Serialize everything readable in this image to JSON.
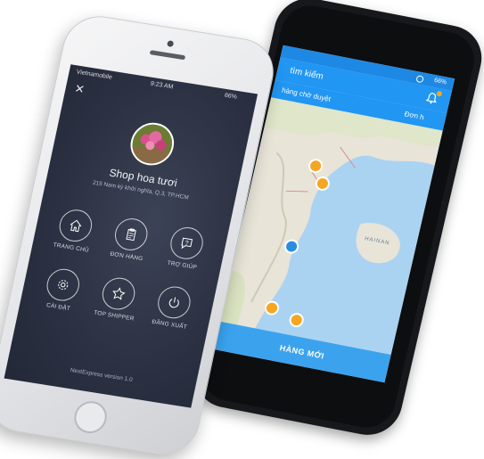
{
  "front": {
    "status": {
      "carrier": "Vietnamobile",
      "time": "9:23 AM",
      "battery": "66%"
    },
    "close_label": "✕",
    "profile": {
      "name": "Shop hoa tươi",
      "address": "215 Nam kỳ khởi nghĩa, Q.3, TP.HCM"
    },
    "menu": [
      {
        "label": "TRANG CHỦ",
        "icon": "home-icon"
      },
      {
        "label": "ĐƠN HÀNG",
        "icon": "orders-icon"
      },
      {
        "label": "TRỢ GIÚP",
        "icon": "help-icon"
      },
      {
        "label": "CÀI ĐẶT",
        "icon": "gear-icon"
      },
      {
        "label": "TOP SHIPPER",
        "icon": "star-icon"
      },
      {
        "label": "ĐĂNG XUẤT",
        "icon": "power-icon"
      }
    ],
    "version": "NextExpress version 1.0"
  },
  "back": {
    "status": {
      "time": "",
      "battery": "66%"
    },
    "header": {
      "search_placeholder": "tìm kiếm"
    },
    "tabs": [
      "hàng chờ duyệt",
      "Đơn h"
    ],
    "map_labels": [
      "HAINAN"
    ],
    "bottom_button": "HÀNG MỚI"
  },
  "colors": {
    "accent": "#2196f3",
    "menu_bg": "#2b3142",
    "pin_orange": "#f5a623",
    "pin_blue": "#2a8de0"
  }
}
